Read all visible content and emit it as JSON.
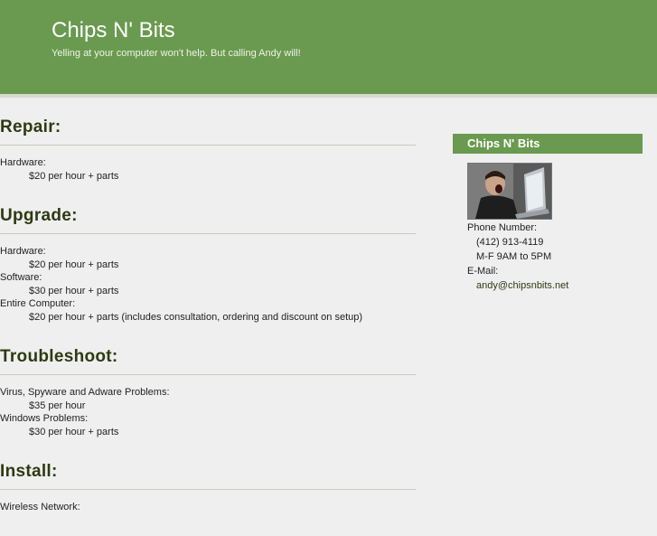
{
  "header": {
    "title": "Chips N' Bits",
    "tagline": "Yelling at your computer won't help. But calling Andy will!"
  },
  "sections": [
    {
      "heading": "Repair:",
      "items": [
        {
          "term": "Hardware:",
          "desc": "$20 per hour + parts"
        }
      ]
    },
    {
      "heading": "Upgrade:",
      "items": [
        {
          "term": "Hardware:",
          "desc": "$20 per hour + parts"
        },
        {
          "term": "Software:",
          "desc": "$30 per hour + parts"
        },
        {
          "term": "Entire Computer:",
          "desc": "$20 per hour + parts (includes consultation, ordering and discount on setup)"
        }
      ]
    },
    {
      "heading": "Troubleshoot:",
      "items": [
        {
          "term": "Virus, Spyware and Adware Problems:",
          "desc": "$35 per hour"
        },
        {
          "term": "Windows Problems:",
          "desc": "$30 per hour + parts"
        }
      ]
    },
    {
      "heading": "Install:",
      "items": [
        {
          "term": "Wireless Network:",
          "desc": ""
        }
      ]
    }
  ],
  "sidebar": {
    "title": "Chips N' Bits",
    "photo_icon": "person-yelling-at-laptop",
    "phone_label": "Phone Number:",
    "phone": "(412) 913-4119",
    "hours": "M-F 9AM to 5PM",
    "email_label": "E-Mail:",
    "email": "andy@chipsnbits.net"
  },
  "colors": {
    "accent": "#6a9a4f",
    "heading": "#2e3a12",
    "background": "#efefef"
  }
}
